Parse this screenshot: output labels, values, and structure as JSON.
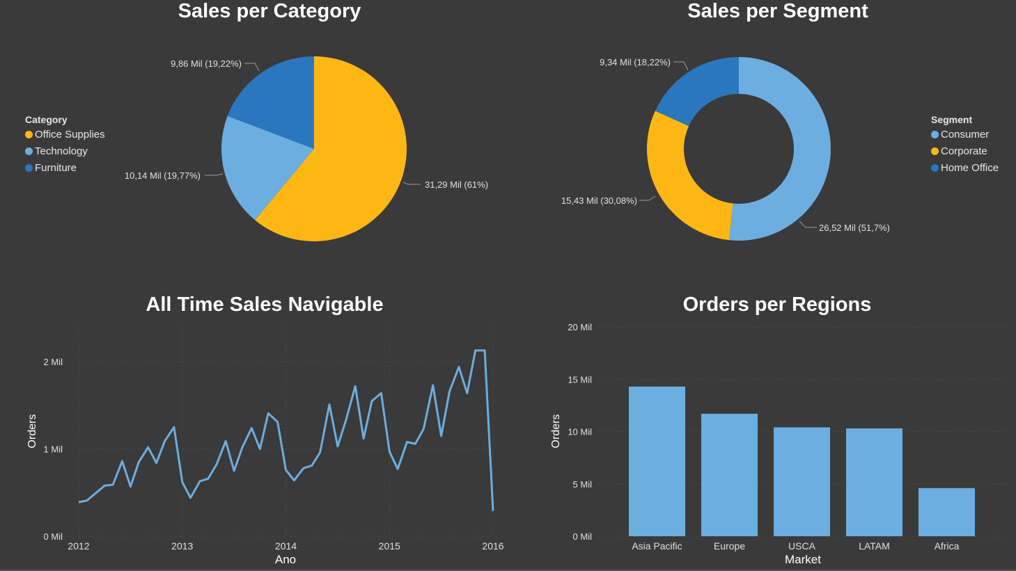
{
  "colors": {
    "background": "#3a3a3a",
    "yellow": "#fdb714",
    "light_blue": "#6caee0",
    "dark_blue": "#2a77bd",
    "line": "#6caee0"
  },
  "category_chart": {
    "title": "Sales per Category",
    "legend_title": "Category",
    "legend": [
      {
        "name": "Office Supplies",
        "color": "#fdb714"
      },
      {
        "name": "Technology",
        "color": "#6caee0"
      },
      {
        "name": "Furniture",
        "color": "#2a77bd"
      }
    ]
  },
  "segment_chart": {
    "title": "Sales per Segment",
    "legend_title": "Segment",
    "legend": [
      {
        "name": "Consumer",
        "color": "#6caee0"
      },
      {
        "name": "Corporate",
        "color": "#fdb714"
      },
      {
        "name": "Home Office",
        "color": "#2a77bd"
      }
    ]
  },
  "line_chart": {
    "title": "All Time Sales Navigable"
  },
  "bar_chart": {
    "title": "Orders per Regions"
  },
  "chart_data": [
    {
      "type": "pie",
      "title": "Sales per Category",
      "legend_title": "Category",
      "legend_position": "left",
      "slices": [
        {
          "name": "Office Supplies",
          "value": 31.29,
          "percent": 61,
          "label": "31,29 Mil (61%)",
          "color": "#fdb714"
        },
        {
          "name": "Technology",
          "value": 10.14,
          "percent": 19.77,
          "label": "10,14 Mil (19,77%)",
          "color": "#6caee0"
        },
        {
          "name": "Furniture",
          "value": 9.86,
          "percent": 19.22,
          "label": "9,86 Mil (19,22%)",
          "color": "#2a77bd"
        }
      ]
    },
    {
      "type": "pie",
      "donut": true,
      "title": "Sales per Segment",
      "legend_title": "Segment",
      "legend_position": "right",
      "slices": [
        {
          "name": "Consumer",
          "value": 26.52,
          "percent": 51.7,
          "label": "26,52 Mil (51,7%)",
          "color": "#6caee0"
        },
        {
          "name": "Corporate",
          "value": 15.43,
          "percent": 30.08,
          "label": "15,43 Mil (30,08%)",
          "color": "#fdb714"
        },
        {
          "name": "Home Office",
          "value": 9.34,
          "percent": 18.22,
          "label": "9,34 Mil (18,22%)",
          "color": "#2a77bd"
        }
      ]
    },
    {
      "type": "line",
      "title": "All Time Sales Navigable",
      "xlabel": "Ano",
      "ylabel": "Orders",
      "x_ticks": [
        "2012",
        "2013",
        "2014",
        "2015",
        "2016"
      ],
      "y_ticks": [
        "0 Mil",
        "1 Mil",
        "2 Mil"
      ],
      "xlim": [
        2012,
        2016
      ],
      "ylim": [
        0,
        2.4
      ],
      "grid": "dotted",
      "series": [
        {
          "values": [
            [
              2012.0,
              0.39
            ],
            [
              2012.08,
              0.41
            ],
            [
              2012.17,
              0.5
            ],
            [
              2012.25,
              0.58
            ],
            [
              2012.33,
              0.59
            ],
            [
              2012.42,
              0.86
            ],
            [
              2012.5,
              0.57
            ],
            [
              2012.58,
              0.85
            ],
            [
              2012.67,
              1.02
            ],
            [
              2012.75,
              0.84
            ],
            [
              2012.83,
              1.09
            ],
            [
              2012.92,
              1.25
            ],
            [
              2013.0,
              0.62
            ],
            [
              2013.08,
              0.44
            ],
            [
              2013.17,
              0.63
            ],
            [
              2013.25,
              0.66
            ],
            [
              2013.33,
              0.82
            ],
            [
              2013.42,
              1.09
            ],
            [
              2013.5,
              0.75
            ],
            [
              2013.58,
              1.02
            ],
            [
              2013.67,
              1.24
            ],
            [
              2013.75,
              1.0
            ],
            [
              2013.83,
              1.41
            ],
            [
              2013.92,
              1.31
            ],
            [
              2014.0,
              0.76
            ],
            [
              2014.08,
              0.64
            ],
            [
              2014.17,
              0.78
            ],
            [
              2014.25,
              0.81
            ],
            [
              2014.33,
              0.96
            ],
            [
              2014.42,
              1.51
            ],
            [
              2014.5,
              1.03
            ],
            [
              2014.58,
              1.33
            ],
            [
              2014.67,
              1.72
            ],
            [
              2014.75,
              1.12
            ],
            [
              2014.83,
              1.55
            ],
            [
              2014.92,
              1.64
            ],
            [
              2015.0,
              0.97
            ],
            [
              2015.08,
              0.77
            ],
            [
              2015.17,
              1.08
            ],
            [
              2015.25,
              1.06
            ],
            [
              2015.33,
              1.23
            ],
            [
              2015.42,
              1.73
            ],
            [
              2015.5,
              1.15
            ],
            [
              2015.58,
              1.66
            ],
            [
              2015.67,
              1.94
            ],
            [
              2015.75,
              1.64
            ],
            [
              2015.83,
              2.13
            ],
            [
              2015.92,
              2.13
            ],
            [
              2016.0,
              0.29
            ]
          ]
        }
      ]
    },
    {
      "type": "bar",
      "title": "Orders per Regions",
      "xlabel": "Market",
      "ylabel": "Orders",
      "categories": [
        "Asia Pacific",
        "Europe",
        "USCA",
        "LATAM",
        "Africa"
      ],
      "values": [
        14.3,
        11.7,
        10.4,
        10.3,
        4.6
      ],
      "y_ticks": [
        "0 Mil",
        "5 Mil",
        "10 Mil",
        "15 Mil",
        "20 Mil"
      ],
      "ylim": [
        0,
        20
      ],
      "grid": "dotted",
      "color": "#6caee0"
    }
  ]
}
